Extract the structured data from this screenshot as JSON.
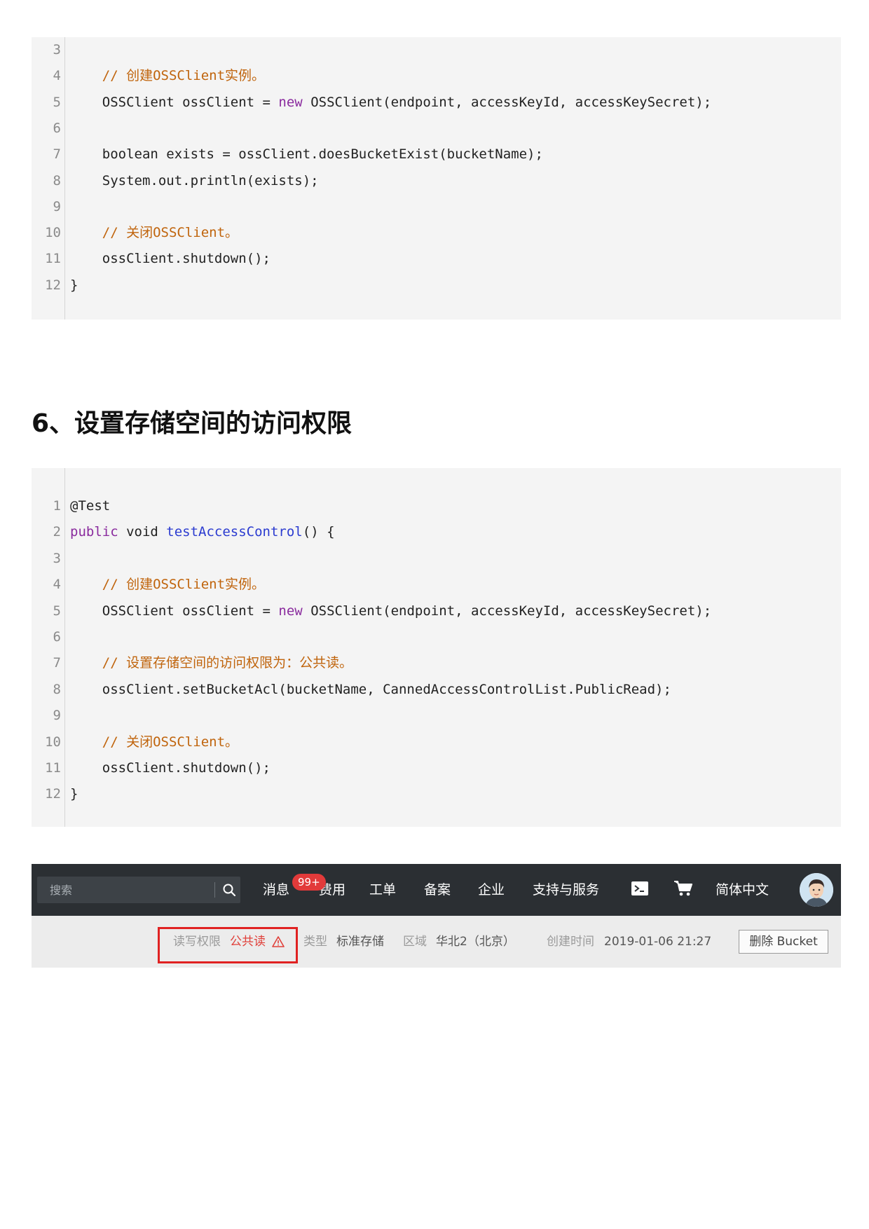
{
  "code_block_1": {
    "lines": [
      {
        "n": "3",
        "parts": []
      },
      {
        "n": "4",
        "parts": [
          {
            "t": "    "
          },
          {
            "t": "// 创建OSSClient实例。",
            "c": "cm"
          }
        ]
      },
      {
        "n": "5",
        "parts": [
          {
            "t": "    OSSClient ossClient = "
          },
          {
            "t": "new",
            "c": "kw"
          },
          {
            "t": " OSSClient(endpoint, accessKeyId, accessKeySecret);"
          }
        ]
      },
      {
        "n": "6",
        "parts": []
      },
      {
        "n": "7",
        "parts": [
          {
            "t": "    boolean exists = ossClient.doesBucketExist(bucketName);"
          }
        ]
      },
      {
        "n": "8",
        "parts": [
          {
            "t": "    System.out.println(exists);"
          }
        ]
      },
      {
        "n": "9",
        "parts": []
      },
      {
        "n": "10",
        "parts": [
          {
            "t": "    "
          },
          {
            "t": "// 关闭OSSClient。",
            "c": "cm"
          }
        ]
      },
      {
        "n": "11",
        "parts": [
          {
            "t": "    ossClient.shutdown();"
          }
        ]
      },
      {
        "n": "12",
        "parts": [
          {
            "t": "}"
          }
        ]
      }
    ]
  },
  "section_title": "6、设置存储空间的访问权限",
  "code_block_2": {
    "lines": [
      {
        "n": "1",
        "parts": [
          {
            "t": "@Test"
          }
        ]
      },
      {
        "n": "2",
        "parts": [
          {
            "t": "public",
            "c": "kw"
          },
          {
            "t": " void "
          },
          {
            "t": "testAccessControl",
            "c": "fn"
          },
          {
            "t": "() {"
          }
        ]
      },
      {
        "n": "3",
        "parts": []
      },
      {
        "n": "4",
        "parts": [
          {
            "t": "    "
          },
          {
            "t": "// 创建OSSClient实例。",
            "c": "cm"
          }
        ]
      },
      {
        "n": "5",
        "parts": [
          {
            "t": "    OSSClient ossClient = "
          },
          {
            "t": "new",
            "c": "kw"
          },
          {
            "t": " OSSClient(endpoint, accessKeyId, accessKeySecret);"
          }
        ]
      },
      {
        "n": "6",
        "parts": []
      },
      {
        "n": "7",
        "parts": [
          {
            "t": "    "
          },
          {
            "t": "// 设置存储空间的访问权限为：公共读。",
            "c": "cm"
          }
        ]
      },
      {
        "n": "8",
        "parts": [
          {
            "t": "    ossClient.setBucketAcl(bucketName, CannedAccessControlList.PublicRead);"
          }
        ]
      },
      {
        "n": "9",
        "parts": []
      },
      {
        "n": "10",
        "parts": [
          {
            "t": "    "
          },
          {
            "t": "// 关闭OSSClient。",
            "c": "cm"
          }
        ]
      },
      {
        "n": "11",
        "parts": [
          {
            "t": "    ossClient.shutdown();"
          }
        ]
      },
      {
        "n": "12",
        "parts": [
          {
            "t": "}"
          }
        ]
      }
    ]
  },
  "console": {
    "search_placeholder": "搜索",
    "nav": {
      "messages": "消息",
      "badge": "99+",
      "billing": "费用",
      "tickets": "工单",
      "icp": "备案",
      "enterprise": "企业",
      "support": "支持与服务",
      "language": "简体中文"
    },
    "icons": {
      "search": "search-icon",
      "terminal": "terminal-icon",
      "cart": "cart-icon",
      "avatar": "avatar"
    },
    "info": {
      "rw_label": "读写权限",
      "rw_value": "公共读",
      "type_label": "类型",
      "type_value": "标准存储",
      "region_label": "区域",
      "region_value": "华北2（北京）",
      "created_label": "创建时间",
      "created_value": "2019-01-06 21:27",
      "delete_button": "删除 Bucket"
    },
    "colors": {
      "topbar": "#2b2f33",
      "badge": "#e23a3a",
      "warning": "#e0403a",
      "highlight": "#e02222"
    }
  }
}
